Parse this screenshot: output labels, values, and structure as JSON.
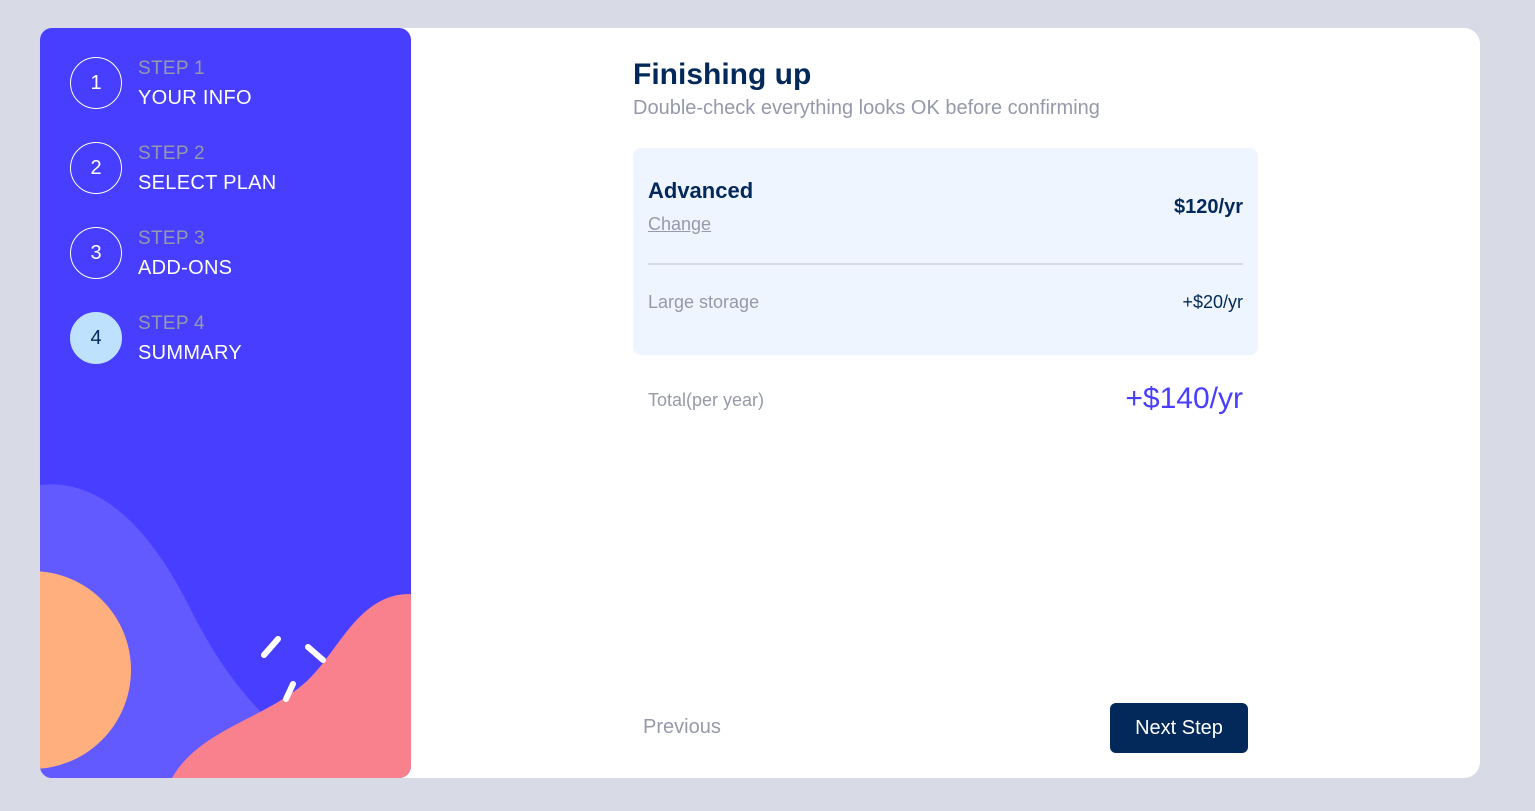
{
  "sidebar": {
    "steps": [
      {
        "number": "1",
        "kicker": "STEP 1",
        "title": "YOUR INFO",
        "active": false
      },
      {
        "number": "2",
        "kicker": "STEP 2",
        "title": "SELECT PLAN",
        "active": false
      },
      {
        "number": "3",
        "kicker": "STEP 3",
        "title": "ADD-ONS",
        "active": false
      },
      {
        "number": "4",
        "kicker": "STEP 4",
        "title": "SUMMARY",
        "active": true
      }
    ]
  },
  "main": {
    "title": "Finishing up",
    "subtitle": "Double-check everything looks OK before confirming",
    "plan": {
      "name": "Advanced",
      "change_label": "Change",
      "price": "$120/yr"
    },
    "addons": [
      {
        "name": "Large storage",
        "price": "+$20/yr"
      }
    ],
    "total": {
      "label": "Total(per year)",
      "value": "+$140/yr"
    }
  },
  "footer": {
    "previous_label": "Previous",
    "next_label": "Next Step"
  },
  "colors": {
    "sidebar_bg": "#483eff",
    "accent": "#483eff",
    "marine_blue": "#022959",
    "active_step": "#bee2fd",
    "muted_text": "#9699aa",
    "summary_bg": "#eef5ff",
    "page_bg": "#d8dbe6"
  }
}
